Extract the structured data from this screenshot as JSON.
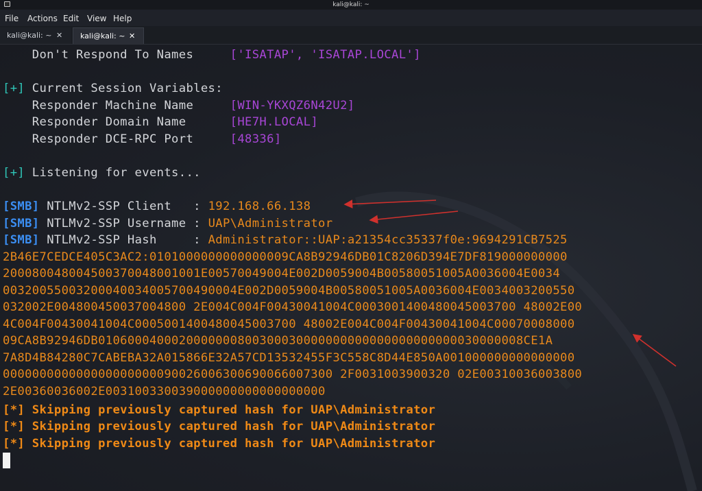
{
  "window": {
    "title": "kali@kali: ~"
  },
  "menu": [
    "File",
    "Actions",
    "Edit",
    "View",
    "Help"
  ],
  "tabs": [
    {
      "label": "kali@kali: ~",
      "close": "✕",
      "active": false
    },
    {
      "label": "kali@kali: ~",
      "close": "✕",
      "active": true
    }
  ],
  "terminal": {
    "dont_respond": {
      "label": "    Don't Respond To Names     ",
      "value": "['ISATAP', 'ISATAP.LOCAL']"
    },
    "session_header": {
      "prefix": "[+]",
      "text": " Current Session Variables:"
    },
    "machine_name": {
      "label": "    Responder Machine Name     ",
      "value": "[WIN-YKXQZ6N42U2]"
    },
    "domain_name": {
      "label": "    Responder Domain Name      ",
      "value": "[HE7H.LOCAL]"
    },
    "dce_port": {
      "label": "    Responder DCE-RPC Port     ",
      "value": "[48336]"
    },
    "listening": {
      "prefix": "[+]",
      "text": " Listening for events..."
    },
    "smb_client": {
      "tag": "[SMB]",
      "label": " NTLMv2-SSP Client   : ",
      "value": "192.168.66.138"
    },
    "smb_username": {
      "tag": "[SMB]",
      "label": " NTLMv2-SSP Username : ",
      "value": "UAP\\Administrator"
    },
    "smb_hash": {
      "tag": "[SMB]",
      "label": " NTLMv2-SSP Hash     : ",
      "value": "Administrator::UAP:a21354cc35337f0e:9694291CB7525"
    },
    "hash_lines": [
      "2B46E7CEDCE405C3AC2:0101000000000000009CA8B92946DB01C8206D394E7DF819000000000",
      "200080048004500370048001001E00570049004E002D0059004B00580051005A0036004E0034",
      "00320055003200040034005700490004E002D0059004B00580051005A0036004E0034003200550",
      "032002E004800450037004800 2E004C004F00430041004C0003001400480045003700 48002E00",
      "4C004F00430041004C0005001400480045003700 48002E004C004F00430041004C00070008000",
      "09CA8B92946DB0106000400020000000800300030000000000000000000000030000008CE1A",
      "7A8D4B84280C7CABEBA32A015866E32A57CD13532455F3C558C8D44E850A001000000000000000",
      "000000000000000000000090026006300690066007300 2F0031003900320 02E00310036003800",
      "2E00360036002E003100330039000000000000000000"
    ],
    "skipping": [
      {
        "prefix": "[*]",
        "text": " Skipping previously captured hash for UAP\\Administrator"
      },
      {
        "prefix": "[*]",
        "text": " Skipping previously captured hash for UAP\\Administrator"
      },
      {
        "prefix": "[*]",
        "text": " Skipping previously captured hash for UAP\\Administrator"
      }
    ]
  },
  "colors": {
    "background": "#1c1f26",
    "purple": "#a846d6",
    "cyan": "#2fc6b8",
    "blue": "#3b8ef2",
    "orange": "#e8891c",
    "annotation_red": "#d0312d"
  }
}
